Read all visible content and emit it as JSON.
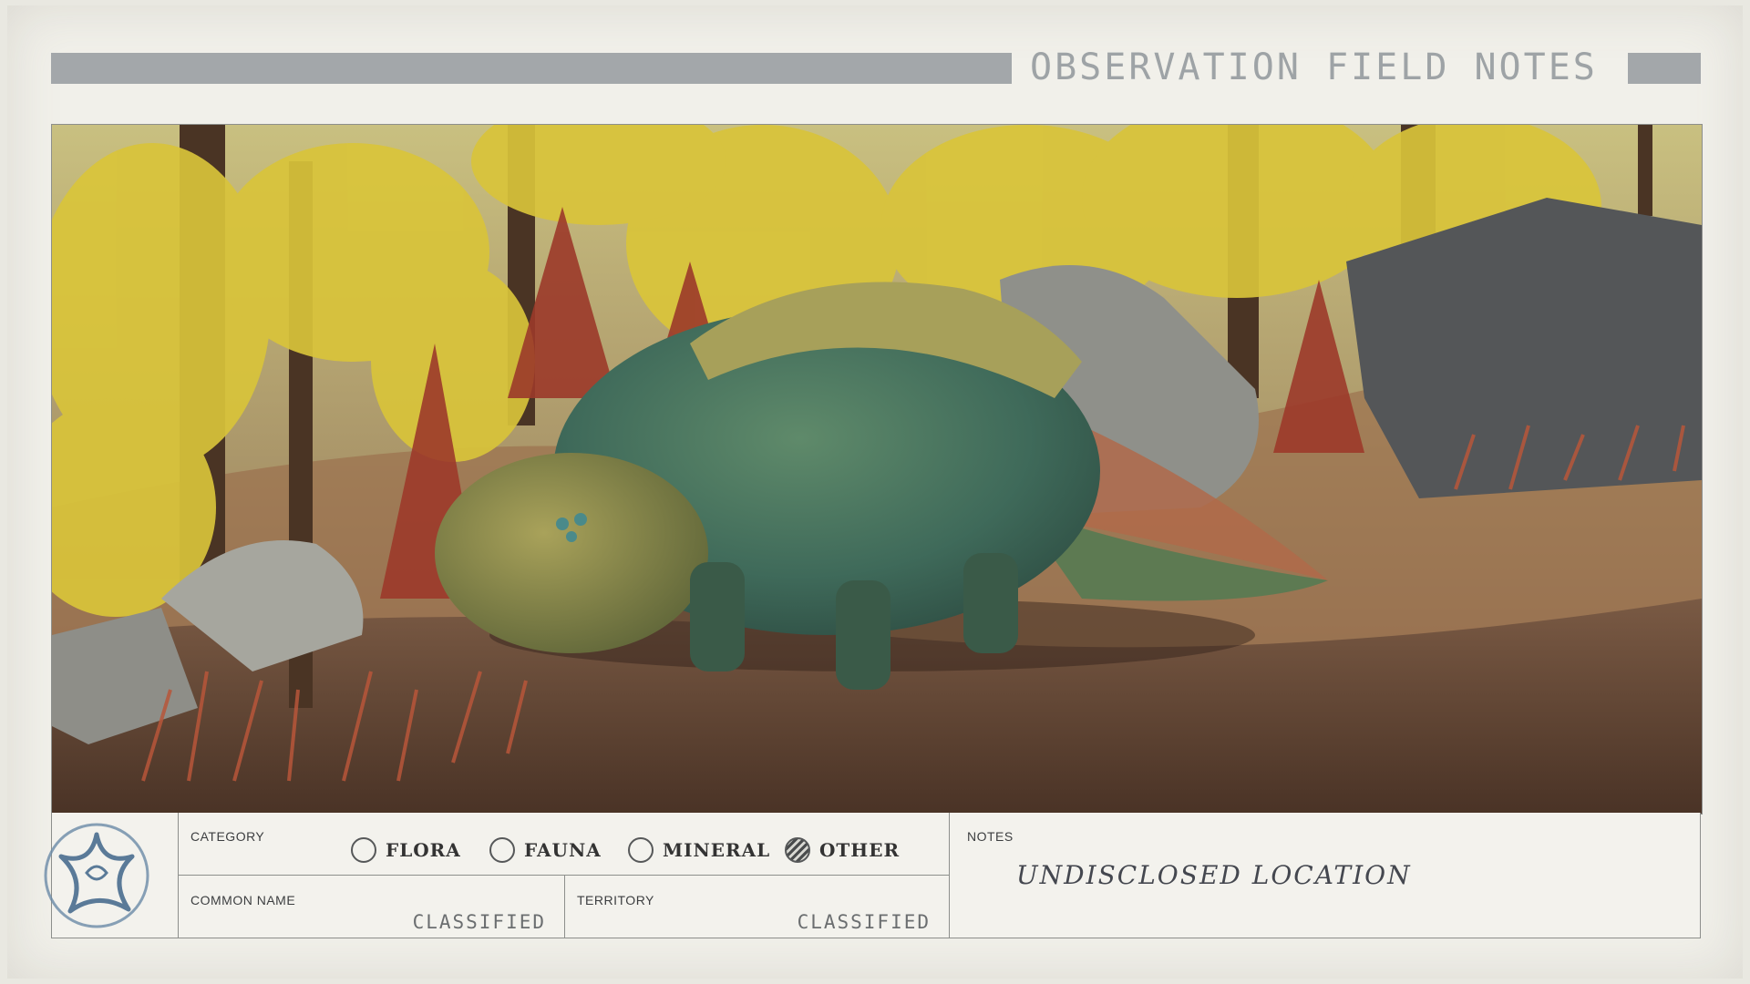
{
  "header": {
    "title": "OBSERVATION FIELD NOTES"
  },
  "photo": {
    "subject_icon": "creature-photo"
  },
  "category": {
    "label": "CATEGORY",
    "options": [
      {
        "label": "FLORA",
        "selected": false
      },
      {
        "label": "FAUNA",
        "selected": false
      },
      {
        "label": "MINERAL",
        "selected": false
      },
      {
        "label": "OTHER",
        "selected": true
      }
    ]
  },
  "common_name": {
    "label": "COMMON NAME",
    "value": "CLASSIFIED"
  },
  "territory": {
    "label": "TERRITORY",
    "value": "CLASSIFIED"
  },
  "notes": {
    "label": "NOTES",
    "value": "UNDISCLOSED LOCATION"
  },
  "colors": {
    "paper": "#f1f0ea",
    "header_bar": "#a3a7aa",
    "ink": "#3c3e40",
    "emblem": "#6a8aa6"
  }
}
